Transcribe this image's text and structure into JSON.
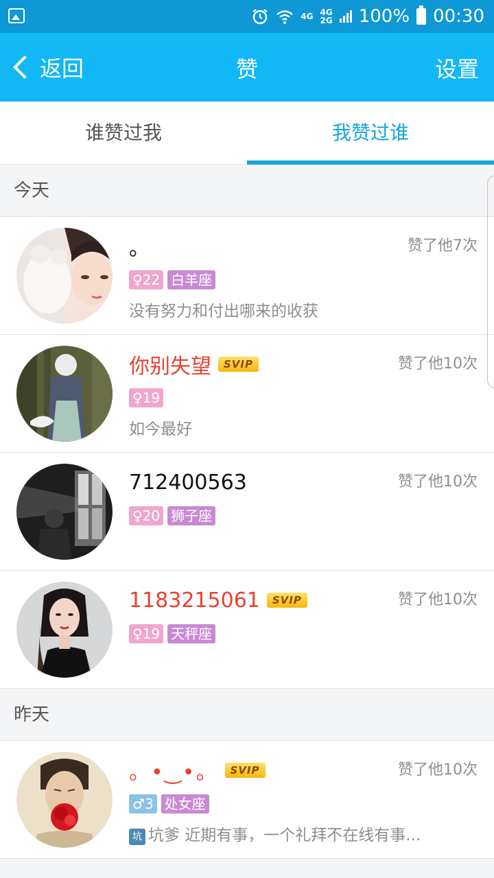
{
  "statusbar": {
    "network_top": "4G",
    "network_mid": "4G",
    "network_bottom": "2G",
    "battery_text": "100%",
    "time": "00:30"
  },
  "header": {
    "back_label": "返回",
    "title": "赞",
    "settings_label": "设置"
  },
  "tabs": [
    {
      "label": "谁赞过我",
      "active": false
    },
    {
      "label": "我赞过谁",
      "active": true
    }
  ],
  "sections": [
    {
      "label": "今天",
      "items": [
        {
          "name": "。",
          "svip": "",
          "count": "赞了他7次",
          "gender": "♀",
          "age": "22",
          "zodiac": "白羊座",
          "signature": "没有努力和付出哪来的收获"
        },
        {
          "name": "你别失望",
          "svip": "SVIP",
          "count": "赞了他10次",
          "gender": "♀",
          "age": "19",
          "zodiac": "",
          "signature": "如今最好"
        },
        {
          "name": "712400563",
          "svip": "",
          "count": "赞了他10次",
          "gender": "♀",
          "age": "20",
          "zodiac": "狮子座",
          "signature": ""
        },
        {
          "name": "1183215061",
          "svip": "SVIP",
          "count": "赞了他10次",
          "gender": "♀",
          "age": "19",
          "zodiac": "天秤座",
          "signature": ""
        }
      ]
    },
    {
      "label": "昨天",
      "items": [
        {
          "name": "。•‿•。",
          "svip": "SVIP",
          "count": "赞了他10次",
          "gender": "♂",
          "age": "3",
          "zodiac": "处女座",
          "signature_badge": "坑",
          "signature": "坑爹 近期有事，一个礼拜不在线有事..."
        }
      ]
    }
  ],
  "colors": {
    "statusbar": "#0e98d6",
    "titlebar": "#12b7f5",
    "accent": "#12a6dc",
    "svip_name": "#e8412f"
  }
}
